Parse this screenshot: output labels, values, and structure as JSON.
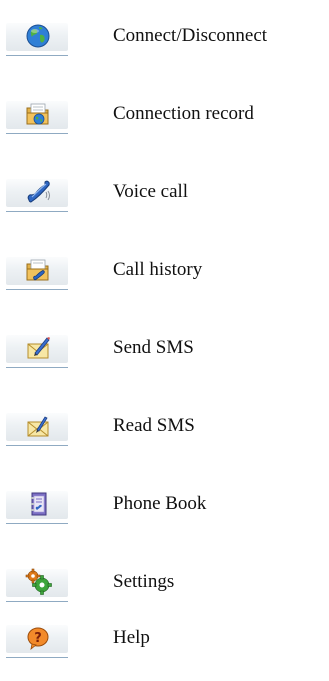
{
  "menu": {
    "items": [
      {
        "label": "Connect/Disconnect",
        "icon": "globe-icon"
      },
      {
        "label": "Connection record",
        "icon": "folder-globe-icon"
      },
      {
        "label": "Voice call",
        "icon": "phone-handset-icon"
      },
      {
        "label": "Call history",
        "icon": "folder-phone-icon"
      },
      {
        "label": "Send SMS",
        "icon": "envelope-pen-icon"
      },
      {
        "label": "Read SMS",
        "icon": "envelope-read-icon"
      },
      {
        "label": "Phone Book",
        "icon": "address-book-icon"
      },
      {
        "label": "Settings",
        "icon": "gears-icon"
      },
      {
        "label": "Help",
        "icon": "help-icon"
      }
    ]
  },
  "colors": {
    "icon_tile": "#e8edf1",
    "tile_underline": "#8faac2",
    "text": "#111111"
  }
}
